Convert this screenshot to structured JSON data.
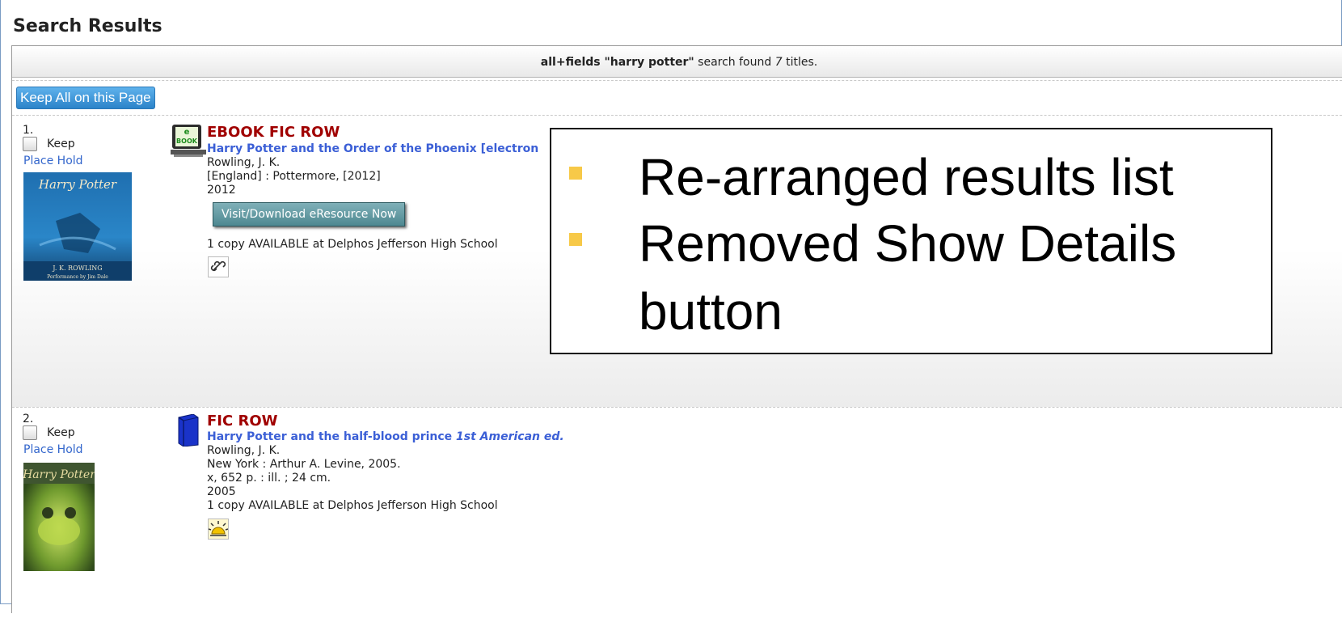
{
  "page": {
    "title": "Search Results",
    "summary": {
      "query_field": "all+fields \"harry potter\"",
      "middle_text": " search found ",
      "count": "7",
      "suffix": " titles."
    },
    "keep_all_label": "Keep All on this Page"
  },
  "results": [
    {
      "number": "1.",
      "keep_label": "Keep",
      "place_hold_label": "Place Hold",
      "format_icon": "ebook-computer-icon",
      "call_number": "EBOOK FIC ROW",
      "title": "Harry Potter and the Order of the Phoenix [electron",
      "author": "Rowling, J. K.",
      "publisher": "[England] : Pottermore, [2012]",
      "year": "2012",
      "action_button": "Visit/Download eResource Now",
      "availability": "1 copy AVAILABLE at Delphos Jefferson High School",
      "extra_icon": "link-icon",
      "cover_text": "Harry Potter",
      "cover_author": "J. K. ROWLING",
      "cover_narrator": "Performance by Jim Dale"
    },
    {
      "number": "2.",
      "keep_label": "Keep",
      "place_hold_label": "Place Hold",
      "format_icon": "book-icon",
      "call_number": "FIC ROW",
      "title": "Harry Potter and the half-blood prince",
      "edition": "1st American ed.",
      "author": "Rowling, J. K.",
      "publisher": "New York : Arthur A. Levine, 2005.",
      "physical": "x, 652 p. : ill. ; 24 cm.",
      "year": "2005",
      "availability": "1 copy AVAILABLE at Delphos Jefferson High School",
      "extra_icon": "sun-icon",
      "cover_text": "Harry Potter"
    }
  ],
  "callout": {
    "bullets": [
      "Re-arranged results list",
      "Removed Show Details",
      "button"
    ],
    "bullet_color": "#f7c948"
  }
}
